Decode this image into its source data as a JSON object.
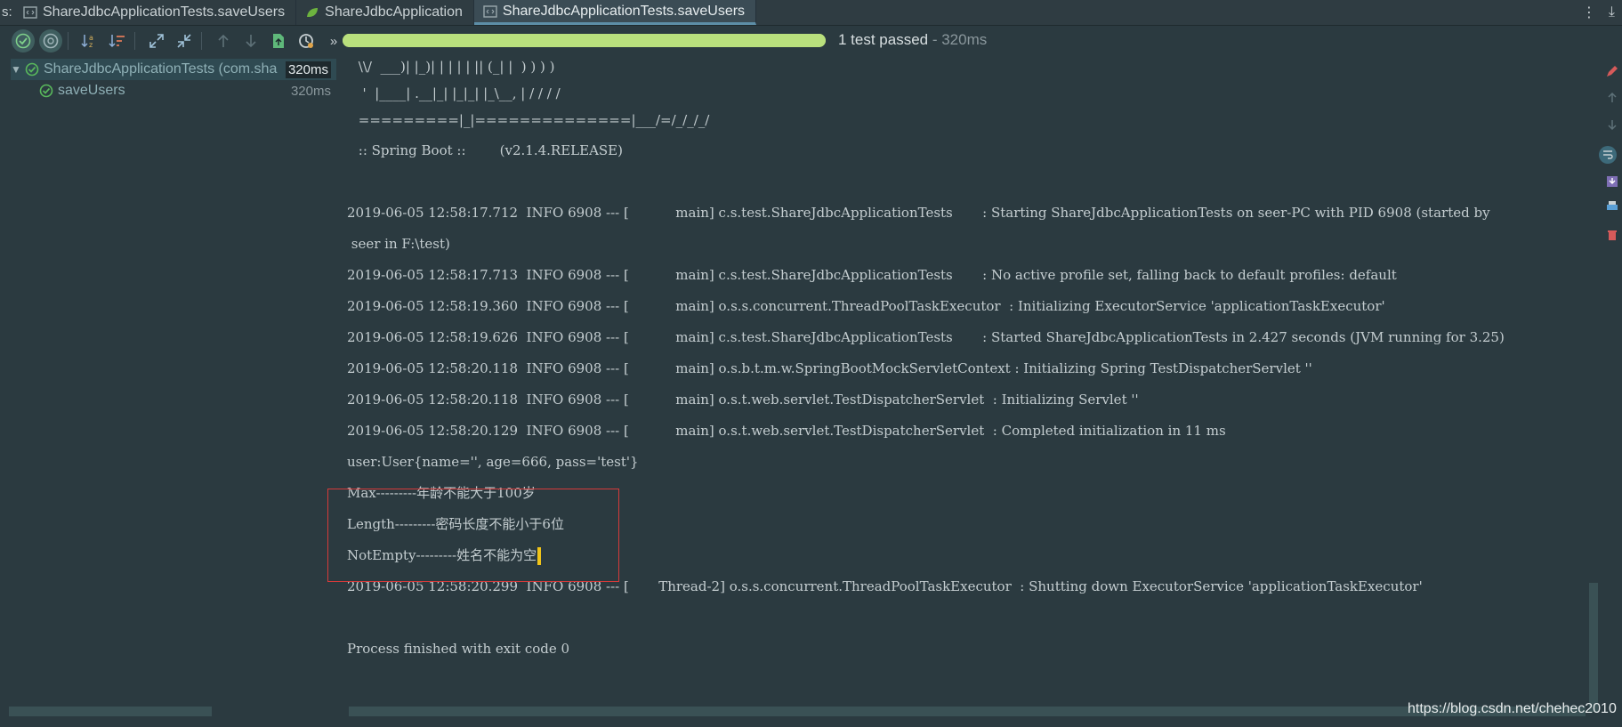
{
  "tabs": {
    "prefix": "s:",
    "items": [
      {
        "label": "ShareJdbcApplicationTests.saveUsers",
        "active": false
      },
      {
        "label": "ShareJdbcApplication",
        "active": false
      },
      {
        "label": "ShareJdbcApplicationTests.saveUsers",
        "active": true
      }
    ]
  },
  "toolbar": {
    "progress_fraction": 1.0,
    "status": "1 test passed",
    "duration": " - 320ms"
  },
  "tree": {
    "root": {
      "label": "ShareJdbcApplicationTests (com.sha",
      "time": "320ms"
    },
    "child": {
      "label": "saveUsers",
      "time": "320ms"
    }
  },
  "console": {
    "lines": [
      " \\\\/  ___)| |_)| | | | | || (_| |  ) ) ) )",
      "  '  |____| .__|_| |_|_| |_\\__, | / / / /",
      " =========|_|==============|___/=/_/_/_/",
      " :: Spring Boot ::        (v2.1.4.RELEASE)",
      "",
      "2019-06-05 12:58:17.712  INFO 6908 --- [           main] c.s.test.ShareJdbcApplicationTests       : Starting ShareJdbcApplicationTests on seer-PC with PID 6908 (started by",
      " seer in F:\\test)",
      "2019-06-05 12:58:17.713  INFO 6908 --- [           main] c.s.test.ShareJdbcApplicationTests       : No active profile set, falling back to default profiles: default",
      "2019-06-05 12:58:19.360  INFO 6908 --- [           main] o.s.s.concurrent.ThreadPoolTaskExecutor  : Initializing ExecutorService 'applicationTaskExecutor'",
      "2019-06-05 12:58:19.626  INFO 6908 --- [           main] c.s.test.ShareJdbcApplicationTests       : Started ShareJdbcApplicationTests in 2.427 seconds (JVM running for 3.25)",
      "2019-06-05 12:58:20.118  INFO 6908 --- [           main] o.s.b.t.m.w.SpringBootMockServletContext : Initializing Spring TestDispatcherServlet ''",
      "2019-06-05 12:58:20.118  INFO 6908 --- [           main] o.s.t.web.servlet.TestDispatcherServlet  : Initializing Servlet ''",
      "2019-06-05 12:58:20.129  INFO 6908 --- [           main] o.s.t.web.servlet.TestDispatcherServlet  : Completed initialization in 11 ms",
      "user:User{name='', age=666, pass='test'}",
      "Max---------年龄不能大于100岁",
      "Length---------密码长度不能小于6位",
      "NotEmpty---------姓名不能为空",
      "2019-06-05 12:58:20.299  INFO 6908 --- [       Thread-2] o.s.s.concurrent.ThreadPoolTaskExecutor  : Shutting down ExecutorService 'applicationTaskExecutor'",
      "",
      "Process finished with exit code 0"
    ]
  },
  "watermark": "https://blog.csdn.net/chehec2010",
  "colors": {
    "background": "#2b3a40",
    "progress": "#b9e07d",
    "pass_green": "#59b85c",
    "highlight_border": "#d63a3a",
    "cursor": "#f0c419"
  },
  "icons": {
    "toolbar": [
      "rerun-icon",
      "rerun-failed-icon",
      "sort-alpha-icon",
      "sort-duration-icon",
      "expand-icon",
      "collapse-icon",
      "prev-icon",
      "next-icon",
      "export-icon",
      "history-icon",
      "more-icon"
    ],
    "gutter": [
      "pencil-icon",
      "up-icon",
      "down-icon",
      "wrap-icon",
      "scroll-end-icon",
      "print-icon",
      "trash-icon"
    ]
  }
}
